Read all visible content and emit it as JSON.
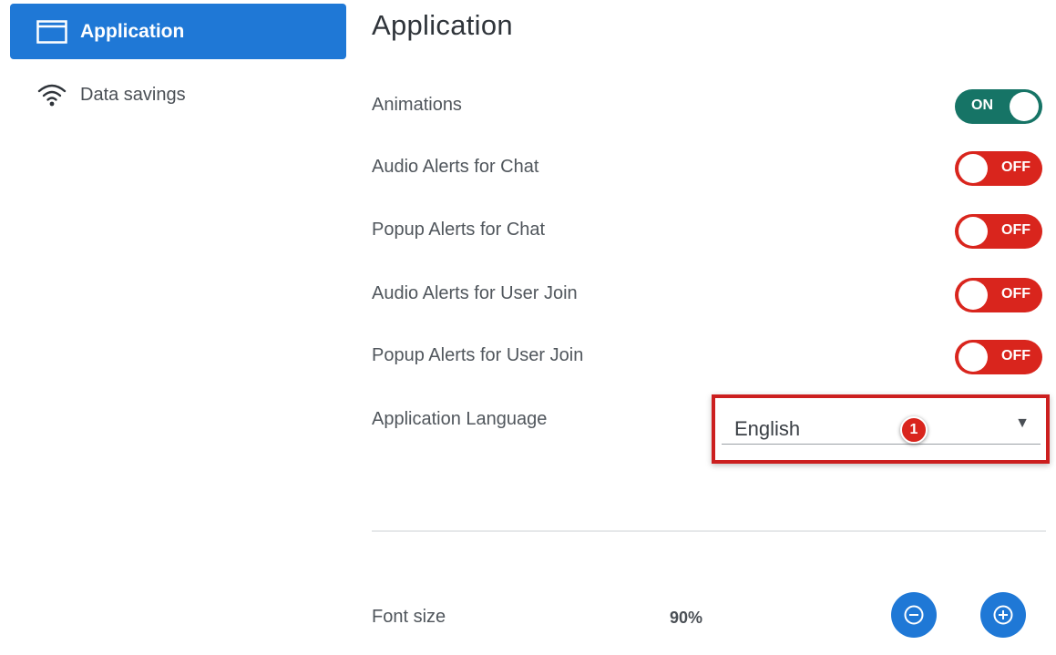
{
  "colors": {
    "accent": "#1f78d6",
    "on": "#167466",
    "off": "#d9251d",
    "highlight": "#cc1f1f"
  },
  "sidebar": {
    "items": [
      {
        "label": "Application",
        "icon": "window-icon",
        "active": true
      },
      {
        "label": "Data savings",
        "icon": "wifi-icon",
        "active": false
      }
    ]
  },
  "main": {
    "title": "Application",
    "settings": [
      {
        "label": "Animations",
        "state": "ON"
      },
      {
        "label": "Audio Alerts for Chat",
        "state": "OFF"
      },
      {
        "label": "Popup Alerts for Chat",
        "state": "OFF"
      },
      {
        "label": "Audio Alerts for User Join",
        "state": "OFF"
      },
      {
        "label": "Popup Alerts for User Join",
        "state": "OFF"
      }
    ],
    "language": {
      "label": "Application Language",
      "value": "English",
      "marker": "1"
    },
    "font_size": {
      "label": "Font size",
      "value": "90%",
      "decrease_icon": "minus-circle-icon",
      "increase_icon": "plus-circle-icon"
    }
  }
}
